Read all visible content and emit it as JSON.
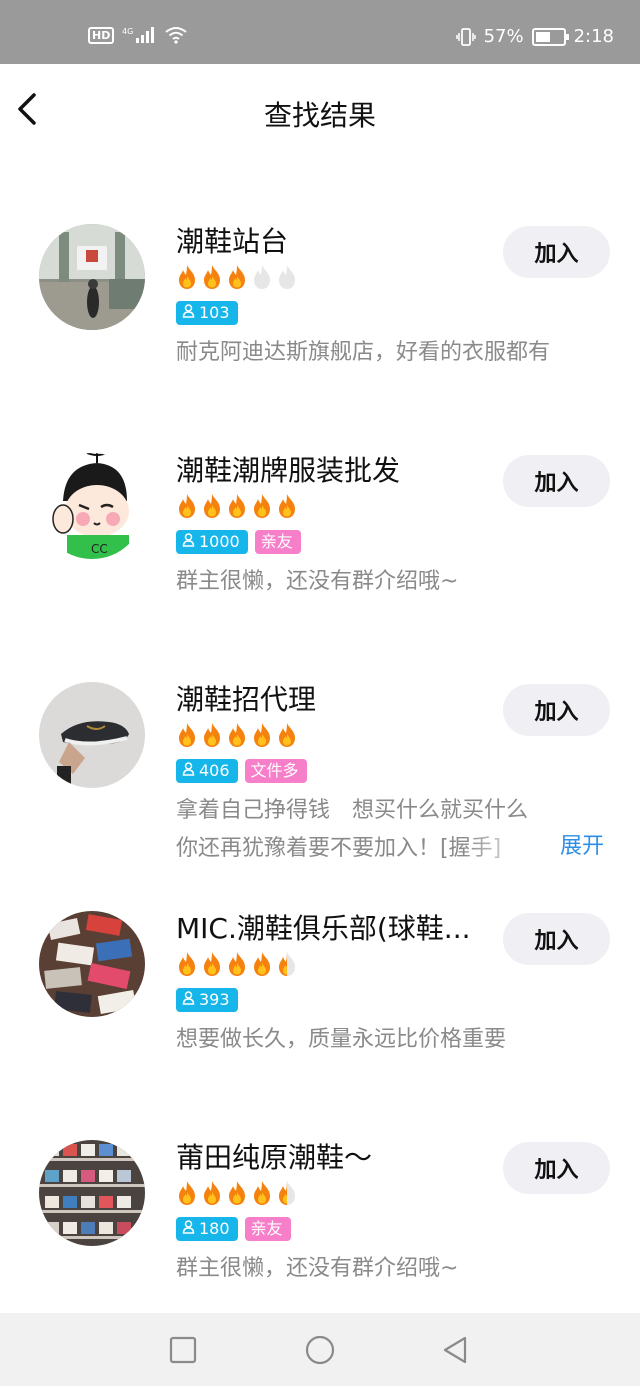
{
  "status_bar": {
    "left_icons": [
      "hd-icon",
      "4g-signal-icon",
      "wifi-icon"
    ],
    "hd_label": "HD",
    "battery_percent": "57%",
    "battery_level": 0.57,
    "time": "2:18"
  },
  "header": {
    "title": "查找结果"
  },
  "groups": [
    {
      "name": "潮鞋站台",
      "flames": 3,
      "members": "103",
      "tags": [],
      "desc_lines": [
        "耐克阿迪达斯旗舰店，好看的衣服都有"
      ],
      "join_label": "加入"
    },
    {
      "name": "潮鞋潮牌服装批发",
      "flames": 5,
      "members": "1000",
      "tags": [
        "亲友"
      ],
      "desc_lines": [
        "群主很懒，还没有群介绍哦~"
      ],
      "join_label": "加入"
    },
    {
      "name": "潮鞋招代理",
      "flames": 5,
      "members": "406",
      "tags": [
        "文件多"
      ],
      "desc_lines": [
        "拿着自己挣得钱　想买什么就买什么",
        "你还再犹豫着要不要加入！[握手]"
      ],
      "expand_label": "展开",
      "join_label": "加入"
    },
    {
      "name": "MIC.潮鞋俱乐部(球鞋...",
      "flames": 4.5,
      "members": "393",
      "tags": [],
      "desc_lines": [
        "想要做长久，质量永远比价格重要"
      ],
      "join_label": "加入"
    },
    {
      "name": "莆田纯原潮鞋～",
      "flames": 4.5,
      "members": "180",
      "tags": [
        "亲友"
      ],
      "desc_lines": [
        "群主很懒，还没有群介绍哦~"
      ],
      "join_label": "加入"
    }
  ],
  "nav_bar": {
    "buttons": [
      "recent-apps-icon",
      "home-icon",
      "back-triangle-icon"
    ]
  }
}
